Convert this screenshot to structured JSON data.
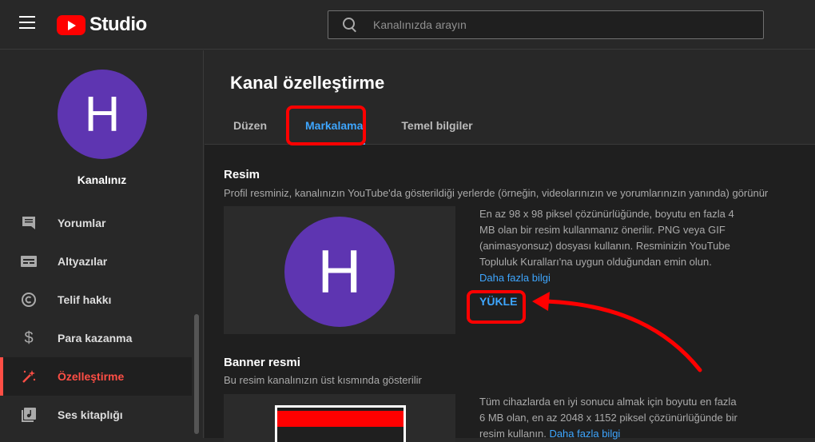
{
  "app": {
    "logo_text": "Studio"
  },
  "search": {
    "placeholder": "Kanalınızda arayın"
  },
  "sidebar": {
    "avatar_letter": "H",
    "channel_name": "Kanalınız",
    "items": [
      {
        "label": "Yorumlar",
        "icon": "comment-icon"
      },
      {
        "label": "Altyazılar",
        "icon": "subtitles-icon"
      },
      {
        "label": "Telif hakkı",
        "icon": "copyright-icon"
      },
      {
        "label": "Para kazanma",
        "icon": "dollar-icon"
      },
      {
        "label": "Özelleştirme",
        "icon": "magic-wand-icon",
        "active": true
      },
      {
        "label": "Ses kitaplığı",
        "icon": "music-library-icon"
      }
    ]
  },
  "main": {
    "title": "Kanal özelleştirme",
    "tabs": [
      {
        "label": "Düzen"
      },
      {
        "label": "Markalama",
        "active": true
      },
      {
        "label": "Temel bilgiler"
      }
    ],
    "picture": {
      "title": "Resim",
      "desc": "Profil resminiz, kanalınızın YouTube'da gösterildiği yerlerde (örneğin, videolarınızın ve yorumlarınızın yanında) görünür",
      "avatar_letter": "H",
      "info_1": "En az 98 x 98 piksel çözünürlüğünde, boyutu en fazla 4",
      "info_2": "MB olan bir resim kullanmanız önerilir. PNG veya GIF",
      "info_3": "(animasyonsuz) dosyası kullanın. Resminizin YouTube",
      "info_4": "Topluluk Kuralları'na uygun olduğundan emin olun.",
      "more_link": "Daha fazla bilgi",
      "upload_label": "YÜKLE"
    },
    "banner": {
      "title": "Banner resmi",
      "desc": "Bu resim kanalınızın üst kısmında gösterilir",
      "info_1": "Tüm cihazlarda en iyi sonucu almak için boyutu en fazla",
      "info_2": "6 MB olan, en az 2048 x 1152 piksel çözünürlüğünde bir",
      "info_3": "resim kullanın.",
      "more_link": "Daha fazla bilgi"
    }
  },
  "colors": {
    "accent": "#3ea6ff",
    "highlight": "#ff0000",
    "avatar": "#5e35b1",
    "active_nav": "#ff4e45"
  }
}
